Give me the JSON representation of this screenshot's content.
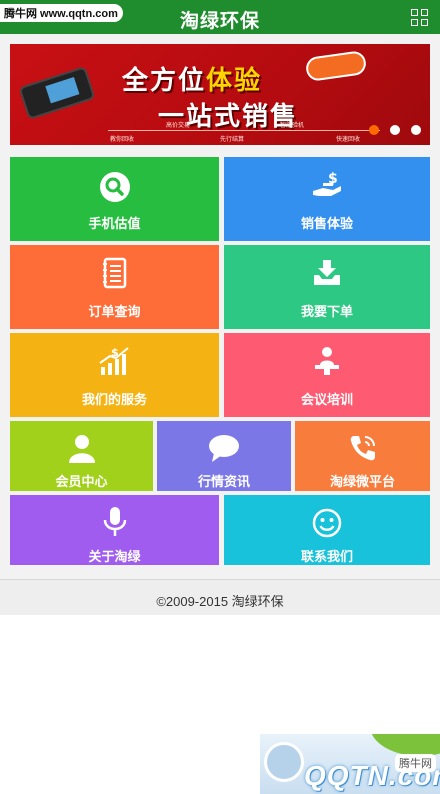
{
  "header": {
    "title": "淘绿环保",
    "watermark_top": "腾牛网 www.qqtn.com",
    "menu_icon": "grid-icon",
    "bg_color": "#1f8c2e"
  },
  "banner": {
    "headline_part1": "全方位",
    "headline_highlight": "体验",
    "headline_line2": "一站式销售",
    "steps": [
      "高价交易",
      "智能验机",
      "教你回收",
      "先行结算",
      "快速回收"
    ],
    "active_slide": 1,
    "slide_count": 3
  },
  "tiles": [
    {
      "label": "手机估值",
      "icon": "search-icon",
      "color": "#26bd40"
    },
    {
      "label": "销售体验",
      "icon": "hand-money-icon",
      "color": "#3490ef"
    },
    {
      "label": "订单查询",
      "icon": "notebook-icon",
      "color": "#fe6d38"
    },
    {
      "label": "我要下单",
      "icon": "download-tray-icon",
      "color": "#2dc884"
    },
    {
      "label": "我们的服务",
      "icon": "growth-chart-icon",
      "color": "#f4b313"
    },
    {
      "label": "会议培训",
      "icon": "presenter-icon",
      "color": "#fe5a72"
    },
    {
      "label": "会员中心",
      "icon": "user-icon",
      "color": "#a2d11c"
    },
    {
      "label": "行情资讯",
      "icon": "speech-bubble-icon",
      "color": "#7b77e6"
    },
    {
      "label": "淘绿微平台",
      "icon": "phone-icon",
      "color": "#f87c3b"
    },
    {
      "label": "关于淘绿",
      "icon": "microphone-icon",
      "color": "#a05cef"
    },
    {
      "label": "联系我们",
      "icon": "smiley-icon",
      "color": "#18c2da"
    }
  ],
  "footer": {
    "copyright": "©2009-2015 淘绿环保"
  },
  "watermark_bottom": {
    "logo": "QQTN.com",
    "tag": "腾牛网"
  }
}
